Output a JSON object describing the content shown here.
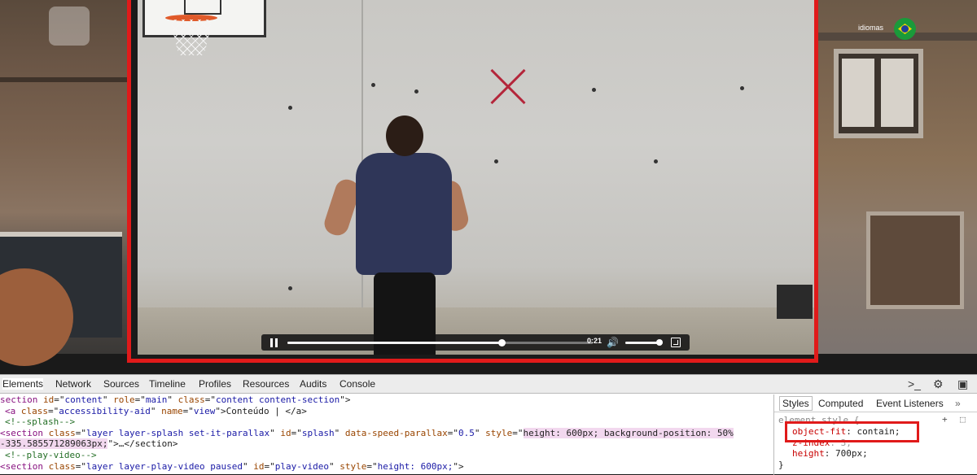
{
  "video": {
    "time": "0:21",
    "progress": 0.7,
    "volume": 0.92
  },
  "language": {
    "label": "idiomas"
  },
  "devtools": {
    "tabs": [
      "Elements",
      "Network",
      "Sources",
      "Timeline",
      "Profiles",
      "Resources",
      "Audits",
      "Console"
    ],
    "active_tab": "Elements",
    "dom_lines": [
      {
        "t": "section",
        "segments": [
          [
            "tag",
            "section "
          ],
          [
            "an",
            "id"
          ],
          [
            "",
            "=\""
          ],
          [
            "av",
            "content"
          ],
          [
            "",
            "\" "
          ],
          [
            "an",
            "role"
          ],
          [
            "",
            "=\""
          ],
          [
            "av",
            "main"
          ],
          [
            "",
            "\" "
          ],
          [
            "an",
            "class"
          ],
          [
            "",
            "=\""
          ],
          [
            "av",
            "content content-section"
          ],
          [
            "",
            "\">"
          ]
        ]
      },
      {
        "segments": [
          [
            "tag",
            "<a "
          ],
          [
            "an",
            "class"
          ],
          [
            "",
            "=\""
          ],
          [
            "av",
            "accessibility-aid"
          ],
          [
            "",
            "\" "
          ],
          [
            "an",
            "name"
          ],
          [
            "",
            "=\""
          ],
          [
            "av",
            "view"
          ],
          [
            "",
            "\">Conteúdo | </a>"
          ]
        ]
      },
      {
        "segments": [
          [
            "cm",
            "<!--splash-->"
          ]
        ]
      },
      {
        "segments": [
          [
            "tag",
            "<section "
          ],
          [
            "an",
            "class"
          ],
          [
            "",
            "=\""
          ],
          [
            "av",
            "layer layer-splash set-it-parallax"
          ],
          [
            "",
            "\" "
          ],
          [
            "an",
            "id"
          ],
          [
            "",
            "=\""
          ],
          [
            "av",
            "splash"
          ],
          [
            "",
            "\" "
          ],
          [
            "an",
            "data-speed-parallax"
          ],
          [
            "",
            "=\""
          ],
          [
            "av",
            "0.5"
          ],
          [
            "",
            "\" "
          ],
          [
            "an",
            "style"
          ],
          [
            "",
            "=\""
          ],
          [
            "hl",
            "height: 600px; background-position: 50%"
          ]
        ]
      },
      {
        "segments": [
          [
            "hl",
            "-335.585571289063px;"
          ],
          [
            "",
            "\">…</section>"
          ]
        ]
      },
      {
        "segments": [
          [
            "cm",
            "<!--play-video-->"
          ]
        ]
      },
      {
        "segments": [
          [
            "tag",
            "<section "
          ],
          [
            "an",
            "class"
          ],
          [
            "",
            "=\""
          ],
          [
            "av",
            "layer layer-play-video paused"
          ],
          [
            "",
            "\" "
          ],
          [
            "an",
            "id"
          ],
          [
            "",
            "=\""
          ],
          [
            "av",
            "play-video"
          ],
          [
            "",
            "\" "
          ],
          [
            "an",
            "style"
          ],
          [
            "",
            "=\""
          ],
          [
            "av",
            "height: 600px;"
          ],
          [
            "",
            "\">"
          ]
        ]
      }
    ],
    "styles_tabs": [
      "Styles",
      "Computed",
      "Event Listeners"
    ],
    "styles_active": "Styles",
    "element_style_header": "element.style {",
    "rules": [
      {
        "prop": "object-fit",
        "value": "contain;"
      },
      {
        "prop": "z-index",
        "value": "3;"
      },
      {
        "prop": "height",
        "value": "700px;"
      }
    ],
    "close_brace": "}"
  }
}
